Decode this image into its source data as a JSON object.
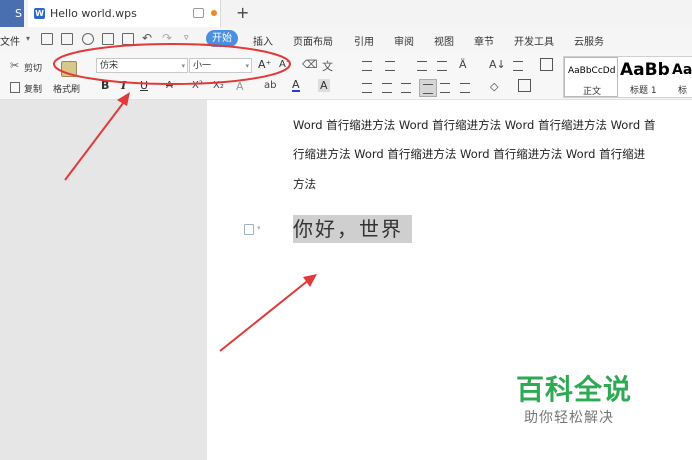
{
  "tabbar": {
    "app_label": "S",
    "doc_tab_icon": "W",
    "doc_tab_title": "Hello world.wps",
    "new_tab": "+"
  },
  "menubar": {
    "file": "文件",
    "items": [
      "开始",
      "插入",
      "页面布局",
      "引用",
      "审阅",
      "视图",
      "章节",
      "开发工具",
      "云服务"
    ]
  },
  "ribbon": {
    "cut": "剪切",
    "copy": "复制",
    "format_painter": "格式刷",
    "font_name": "仿宋",
    "font_size": "小一",
    "bold": "B",
    "italic": "I",
    "underline": "U",
    "styles": [
      {
        "preview": "AaBbCcDd",
        "name": "正文"
      },
      {
        "preview": "AaBb",
        "name": "标题 1"
      },
      {
        "preview": "AaI",
        "name": "标"
      }
    ]
  },
  "document": {
    "line1": "Word 首行缩进方法 Word 首行缩进方法 Word 首行缩进方法 Word 首",
    "line2": "行缩进方法 Word 首行缩进方法 Word 首行缩进方法 Word 首行缩进",
    "line3": "方法",
    "selected_text": "你好，世界"
  },
  "watermark": {
    "title": "百科全说",
    "subtitle": "助你轻松解决"
  },
  "colors": {
    "accent": "#4a8fe0",
    "annotation_red": "#e03a3a",
    "watermark_green": "#2eaa55"
  }
}
